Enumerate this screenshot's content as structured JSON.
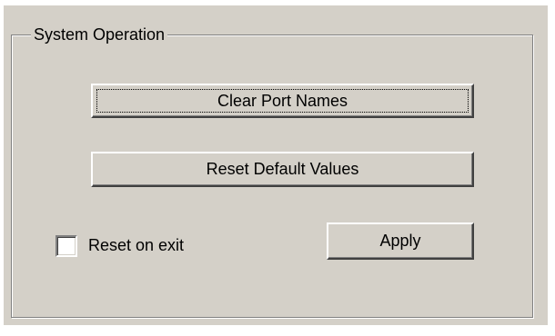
{
  "group": {
    "title": "System Operation"
  },
  "buttons": {
    "clear_port_names": "Clear Port Names",
    "reset_default_values": "Reset Default Values",
    "apply": "Apply"
  },
  "options": {
    "reset_on_exit_label": "Reset on exit",
    "reset_on_exit_checked": false
  },
  "colors": {
    "dialog_bg": "#d4d0c8",
    "text": "#000000"
  }
}
